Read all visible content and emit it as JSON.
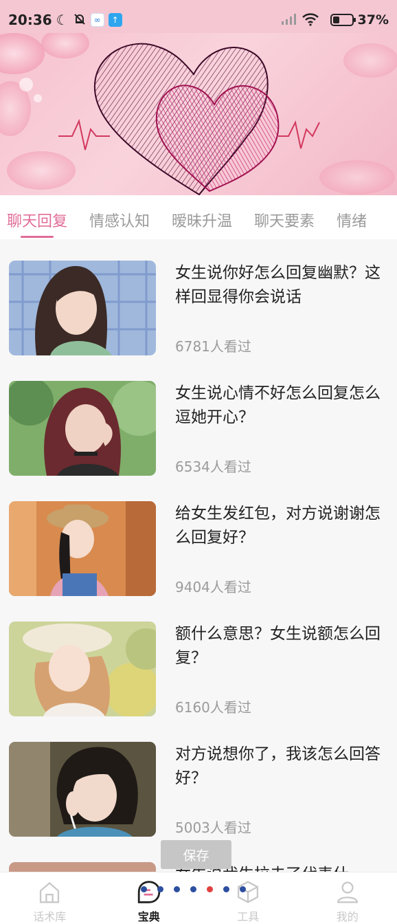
{
  "status_bar": {
    "time": "20:36",
    "battery_level": 0.37,
    "battery_text": "37%",
    "icons": [
      "moon-icon",
      "mute-bell-icon",
      "app-icon-blue",
      "upload-app-icon",
      "signal-icon",
      "wifi-icon",
      "battery-icon"
    ]
  },
  "banner": {
    "icon": "double-heart-banner"
  },
  "tabs": [
    {
      "label": "聊天回复",
      "active": true
    },
    {
      "label": "情感认知",
      "active": false
    },
    {
      "label": "暧昧升温",
      "active": false
    },
    {
      "label": "聊天要素",
      "active": false
    },
    {
      "label": "情绪",
      "active": false
    }
  ],
  "articles": [
    {
      "title": "女生说你好怎么回复幽默？这样回显得你会说话",
      "views": "6781人看过"
    },
    {
      "title": "女生说心情不好怎么回复怎么逗她开心？",
      "views": "6534人看过"
    },
    {
      "title": "给女生发红包，对方说谢谢怎么回复好？",
      "views": "9404人看过"
    },
    {
      "title": "额什么意思？女生说额怎么回复？",
      "views": "6160人看过"
    },
    {
      "title": "对方说想你了，我该怎么回答好？",
      "views": "5003人看过"
    },
    {
      "title": "女生说我生拉去了代表什",
      "views": ""
    }
  ],
  "toast": {
    "label": "保存"
  },
  "pager_dots": [
    {
      "color": "#2d4fa0"
    },
    {
      "color": "#2d4fa0"
    },
    {
      "color": "#2d4fa0"
    },
    {
      "color": "#2d4fa0"
    },
    {
      "color": "#e0413f"
    },
    {
      "color": "#2d4fa0"
    },
    {
      "color": "#2d4fa0"
    }
  ],
  "bottom_nav": [
    {
      "label": "话术库",
      "icon": "home-icon",
      "active": false
    },
    {
      "label": "宝典",
      "icon": "chat-book-icon",
      "active": true
    },
    {
      "label": "工具",
      "icon": "box-icon",
      "active": false
    },
    {
      "label": "我的",
      "icon": "user-icon",
      "active": false
    }
  ],
  "colors": {
    "accent": "#e06d97",
    "status_bg": "#f5c7d3"
  }
}
